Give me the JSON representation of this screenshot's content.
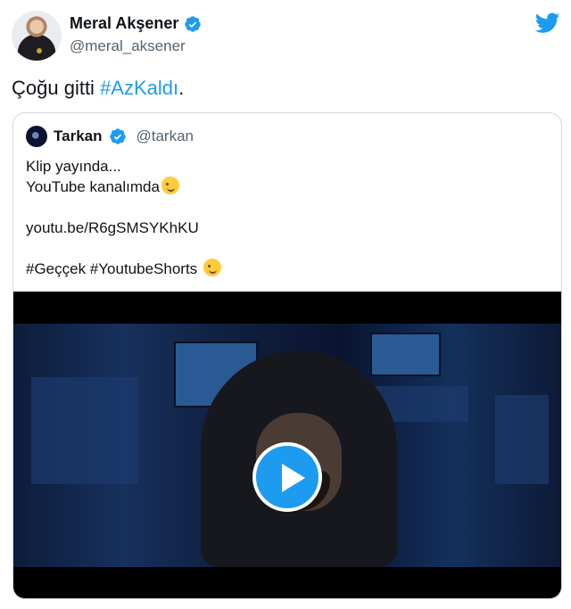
{
  "author": {
    "name": "Meral Akşener",
    "handle": "@meral_aksener"
  },
  "tweet": {
    "text_prefix": "Çoğu gitti ",
    "hashtag": "#AzKaldı",
    "text_suffix": "."
  },
  "quoted": {
    "name": "Tarkan",
    "handle": "@tarkan",
    "lines": [
      "Klip yayında...",
      "YouTube kanalımda",
      "",
      "youtu.be/R6gSMSYKhKU",
      "",
      "#Geççek #YoutubeShorts "
    ]
  },
  "icons": {
    "verified": "verified-badge-icon",
    "bird": "twitter-bird-icon",
    "play": "play-icon",
    "wink_emoji": "winking-face-emoji",
    "kiss_emoji": "face-blowing-kiss-emoji"
  },
  "colors": {
    "accent": "#1d9bf0",
    "text": "#0f1419",
    "muted": "#536471",
    "border": "#cfd9de"
  }
}
